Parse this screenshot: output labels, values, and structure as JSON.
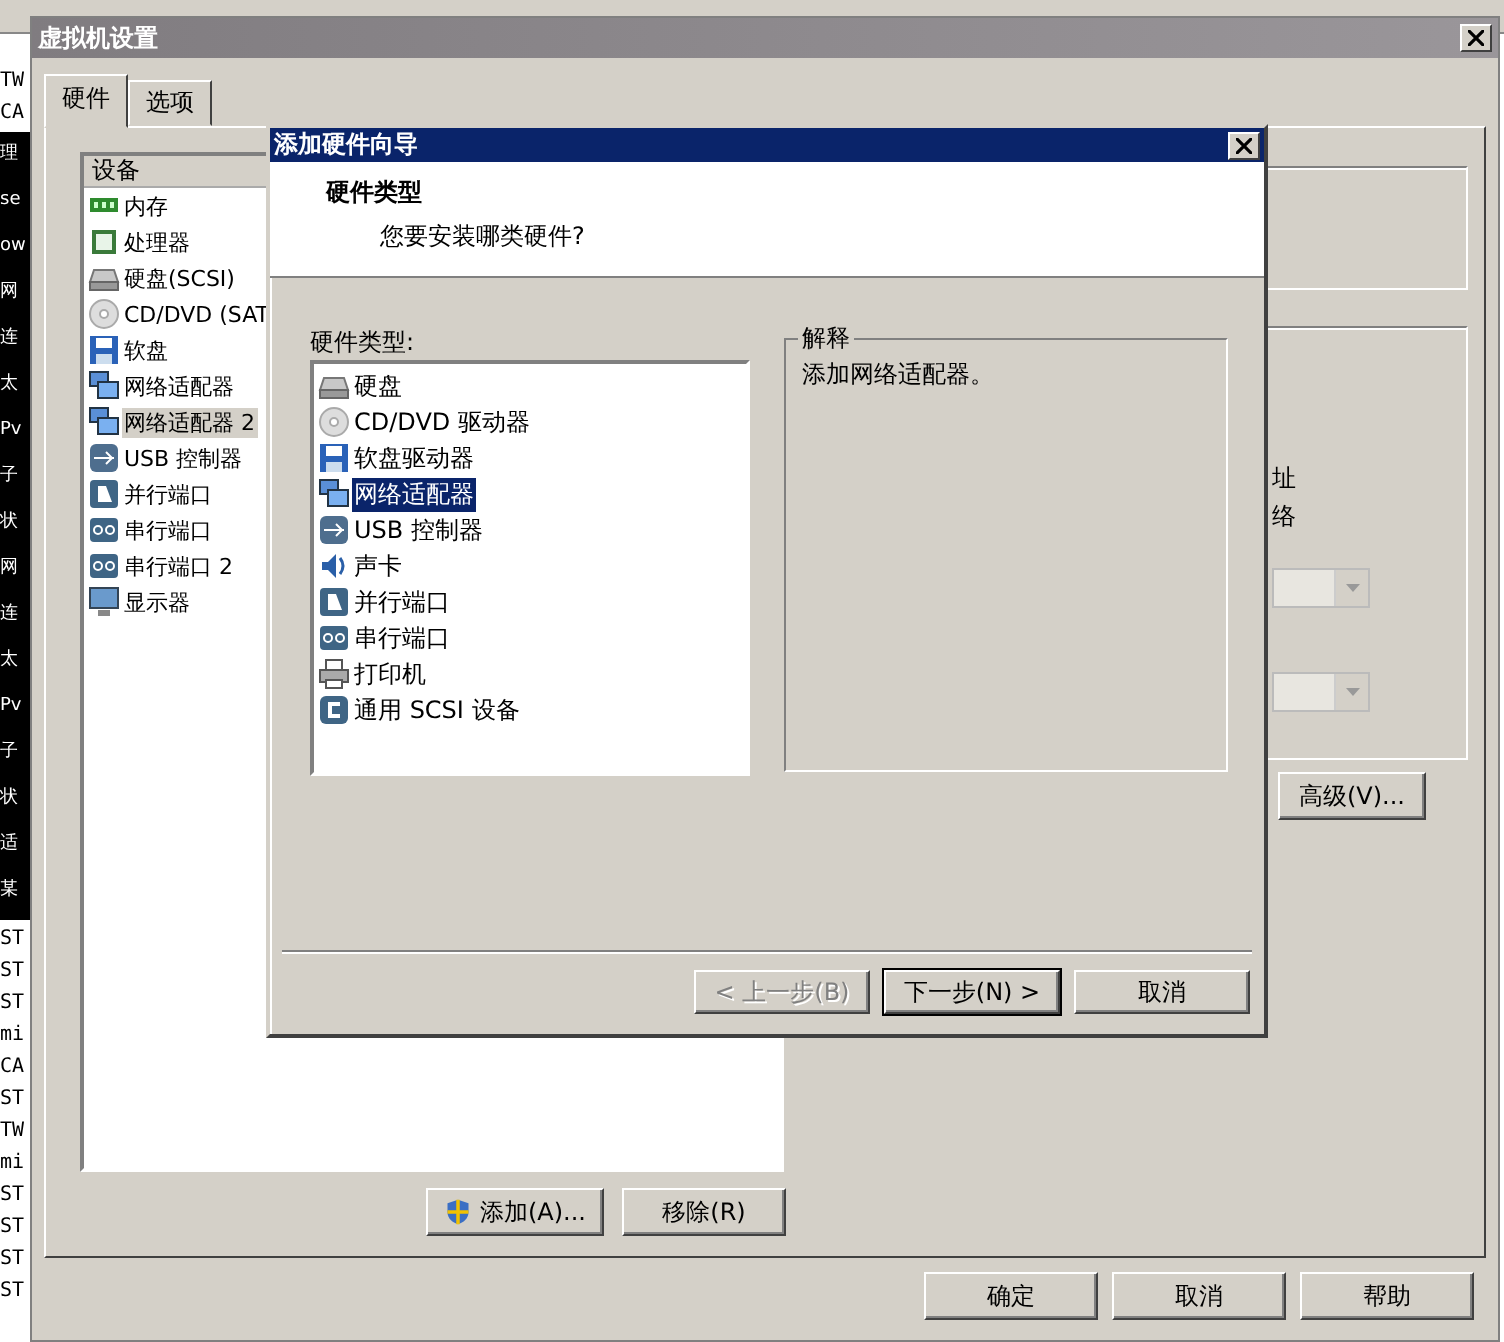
{
  "background_window": {
    "top_rows": [
      "TW",
      "CA"
    ],
    "console_lines": [
      "理",
      "se",
      "ow",
      "网",
      "连",
      "太",
      "Pv",
      "子",
      "状",
      "网",
      "连",
      "太",
      "Pv",
      "子",
      "状",
      "适",
      "某"
    ],
    "bottom_rows": [
      "ST",
      "ST",
      "ST",
      "mi",
      "CA",
      "ST",
      "TW",
      "mi",
      "ST",
      "ST",
      "ST",
      "ST"
    ]
  },
  "settings_window": {
    "title": "虚拟机设置",
    "tabs": [
      {
        "label": "硬件",
        "selected": true
      },
      {
        "label": "选项",
        "selected": false
      }
    ],
    "device_list": {
      "header": "设备",
      "items": [
        {
          "kind": "memory",
          "label": "内存",
          "selected": false
        },
        {
          "kind": "cpu",
          "label": "处理器",
          "selected": false
        },
        {
          "kind": "disk",
          "label": "硬盘(SCSI)",
          "selected": false
        },
        {
          "kind": "cdrom",
          "label": "CD/DVD (SAT",
          "selected": false
        },
        {
          "kind": "floppy",
          "label": "软盘",
          "selected": false
        },
        {
          "kind": "network",
          "label": "网络适配器",
          "selected": false
        },
        {
          "kind": "network",
          "label": "网络适配器 2",
          "selected": true
        },
        {
          "kind": "usb",
          "label": "USB 控制器",
          "selected": false
        },
        {
          "kind": "parallel",
          "label": "并行端口",
          "selected": false
        },
        {
          "kind": "serial",
          "label": "串行端口",
          "selected": false
        },
        {
          "kind": "serial",
          "label": "串行端口 2",
          "selected": false
        },
        {
          "kind": "display",
          "label": "显示器",
          "selected": false
        }
      ]
    },
    "add_button": "添加(A)...",
    "remove_button": "移除(R)",
    "right_fragments": [
      "址",
      "络"
    ],
    "advanced_button": "高级(V)...",
    "buttons": [
      "确定",
      "取消",
      "帮助"
    ]
  },
  "wizard": {
    "title": "添加硬件向导",
    "heading": "硬件类型",
    "subheading": "您要安装哪类硬件?",
    "list_label": "硬件类型:",
    "items": [
      {
        "kind": "disk",
        "label": "硬盘",
        "selected": false
      },
      {
        "kind": "cdrom",
        "label": "CD/DVD 驱动器",
        "selected": false
      },
      {
        "kind": "floppy",
        "label": "软盘驱动器",
        "selected": false
      },
      {
        "kind": "network",
        "label": "网络适配器",
        "selected": true
      },
      {
        "kind": "usb",
        "label": "USB 控制器",
        "selected": false
      },
      {
        "kind": "sound",
        "label": "声卡",
        "selected": false
      },
      {
        "kind": "parallel",
        "label": "并行端口",
        "selected": false
      },
      {
        "kind": "serial",
        "label": "串行端口",
        "selected": false
      },
      {
        "kind": "printer",
        "label": "打印机",
        "selected": false
      },
      {
        "kind": "scsi",
        "label": "通用 SCSI 设备",
        "selected": false
      }
    ],
    "explanation_title": "解释",
    "explanation": "添加网络适配器。",
    "buttons": [
      {
        "label": "< 上一步(B)",
        "disabled": true,
        "default": false
      },
      {
        "label": "下一步(N) >",
        "disabled": false,
        "default": true
      },
      {
        "label": "取消",
        "disabled": false,
        "default": false
      }
    ]
  }
}
